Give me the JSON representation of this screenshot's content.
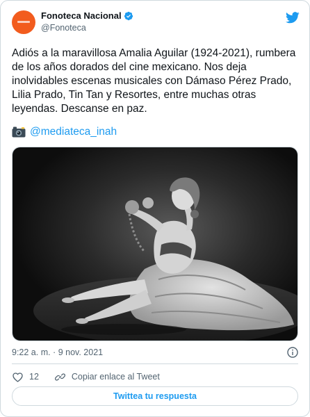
{
  "account": {
    "name": "Fonoteca Nacional",
    "handle": "@Fonoteca",
    "verified": true,
    "avatar_color": "#f25c1e"
  },
  "tweet": {
    "text": "Adiós a la maravillosa Amalia Aguilar (1924-2021), rumbera de los años dorados del cine mexicano. Nos deja inolvidables escenas musicales con Dámaso Pérez Prado, Lilia Prado, Tin Tan y Resortes, entre muchas otras leyendas. Descanse en paz.",
    "credit_emoji": "camera-with-flash-icon",
    "credit_mention": "@mediateca_inah",
    "timestamp": "9:22 a. m. · 9 nov. 2021"
  },
  "actions": {
    "like_count": "12",
    "copy_link_label": "Copiar enlace al Tweet"
  },
  "reply_button_label": "Twittea tu respuesta",
  "colors": {
    "accent": "#1d9bf0",
    "muted_text": "#536471",
    "border": "#cfd9de"
  }
}
